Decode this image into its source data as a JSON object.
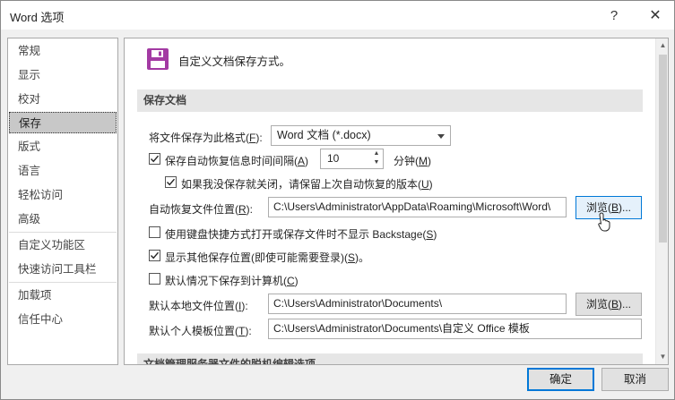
{
  "window": {
    "title": "Word 选项",
    "help": "?",
    "close": "✕"
  },
  "sidebar": {
    "items": [
      {
        "label": "常规"
      },
      {
        "label": "显示"
      },
      {
        "label": "校对"
      },
      {
        "label": "保存",
        "active": true
      },
      {
        "label": "版式"
      },
      {
        "label": "语言"
      },
      {
        "label": "轻松访问"
      },
      {
        "label": "高级"
      },
      {
        "label": "自定义功能区"
      },
      {
        "label": "快速访问工具栏"
      },
      {
        "label": "加载项"
      },
      {
        "label": "信任中心"
      }
    ]
  },
  "main": {
    "header": "自定义文档保存方式。",
    "section_save": "保存文档",
    "format": {
      "label_pre": "将文件保存为此格式(",
      "label_key": "F",
      "label_post": "):",
      "value": "Word 文档 (*.docx)"
    },
    "autorecover": {
      "checked": true,
      "label_pre": "保存自动恢复信息时间间隔(",
      "label_key": "A",
      "label_post": ")",
      "value": "10",
      "unit_pre": "分钟(",
      "unit_key": "M",
      "unit_post": ")"
    },
    "keep_last": {
      "checked": true,
      "label_pre": "如果我没保存就关闭，请保留上次自动恢复的版本(",
      "label_key": "U",
      "label_post": ")"
    },
    "autorecover_location": {
      "label_pre": "自动恢复文件位置(",
      "label_key": "R",
      "label_post": "):",
      "value": "C:\\Users\\Administrator\\AppData\\Roaming\\Microsoft\\Word\\",
      "browse_pre": "浏览(",
      "browse_key": "B",
      "browse_post": ")..."
    },
    "no_backstage": {
      "checked": false,
      "label_pre": "使用键盘快捷方式打开或保存文件时不显示 Backstage(",
      "label_key": "S",
      "label_post": ")"
    },
    "show_other_locations": {
      "checked": true,
      "label_pre": "显示其他保存位置(即使可能需要登录)(",
      "label_key": "S",
      "label_post": ")。"
    },
    "save_to_computer": {
      "checked": false,
      "label_pre": "默认情况下保存到计算机(",
      "label_key": "C",
      "label_post": ")"
    },
    "local_location": {
      "label_pre": "默认本地文件位置(",
      "label_key": "I",
      "label_post": "):",
      "value": "C:\\Users\\Administrator\\Documents\\",
      "browse_pre": "浏览(",
      "browse_key": "B",
      "browse_post": ")..."
    },
    "template_location": {
      "label_pre": "默认个人模板位置(",
      "label_key": "T",
      "label_post": "):",
      "value": "C:\\Users\\Administrator\\Documents\\自定义 Office 模板"
    },
    "section_offline": "文档管理服务器文件的脱机编辑选项"
  },
  "footer": {
    "ok": "确定",
    "cancel": "取消"
  },
  "colors": {
    "accent": "#0078d7",
    "save_icon": "#a33aa3"
  }
}
